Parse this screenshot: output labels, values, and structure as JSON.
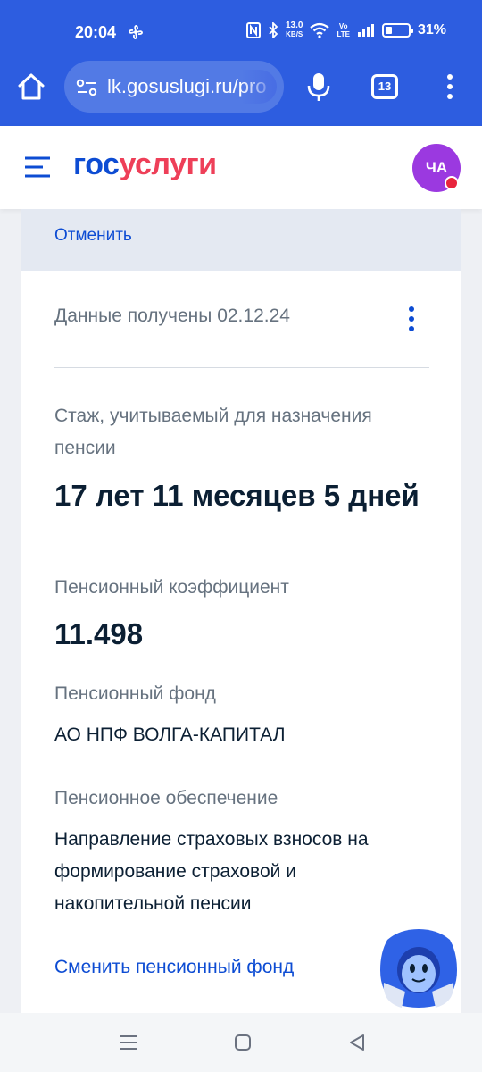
{
  "status_bar": {
    "time": "20:04",
    "network_speed_value": "13.0",
    "network_speed_unit": "KB/S",
    "volte_top": "Vo",
    "volte_bottom": "LTE",
    "battery_percent": "31%",
    "battery_level": 0.31,
    "icons": [
      "fan-icon",
      "nfc-icon",
      "bluetooth-icon",
      "wifi-icon",
      "signal-icon",
      "battery-icon"
    ]
  },
  "browser": {
    "url": "lk.gosuslugi.ru/pro",
    "tab_count": "13",
    "icons": [
      "home-icon",
      "site-settings-icon",
      "mic-icon",
      "kebab-menu-icon"
    ]
  },
  "header": {
    "logo_part1": "гос",
    "logo_part2": "услуги",
    "avatar_initials": "ЧА"
  },
  "card": {
    "cancel_label": "Отменить",
    "data_received": "Данные получены 02.12.24",
    "seniority_label": "Стаж, учитываемый для назначения пенсии",
    "seniority_value": "17 лет 11 месяцев 5 дней",
    "coefficient_label": "Пенсионный коэффициент",
    "coefficient_value": "11.498",
    "fund_label": "Пенсионный фонд",
    "fund_value": "АО НПФ ВОЛГА-КАПИТАЛ",
    "provision_label": "Пенсионное обеспечение",
    "provision_value": "Направление страховых взносов на формирование страховой и накопительной пенсии",
    "change_fund_link": "Сменить пенсионный фонд"
  },
  "colors": {
    "browser_blue": "#2d5de0",
    "brand_blue": "#0d4cd3",
    "brand_red": "#ee3f58",
    "avatar_purple": "#9b39e0"
  }
}
